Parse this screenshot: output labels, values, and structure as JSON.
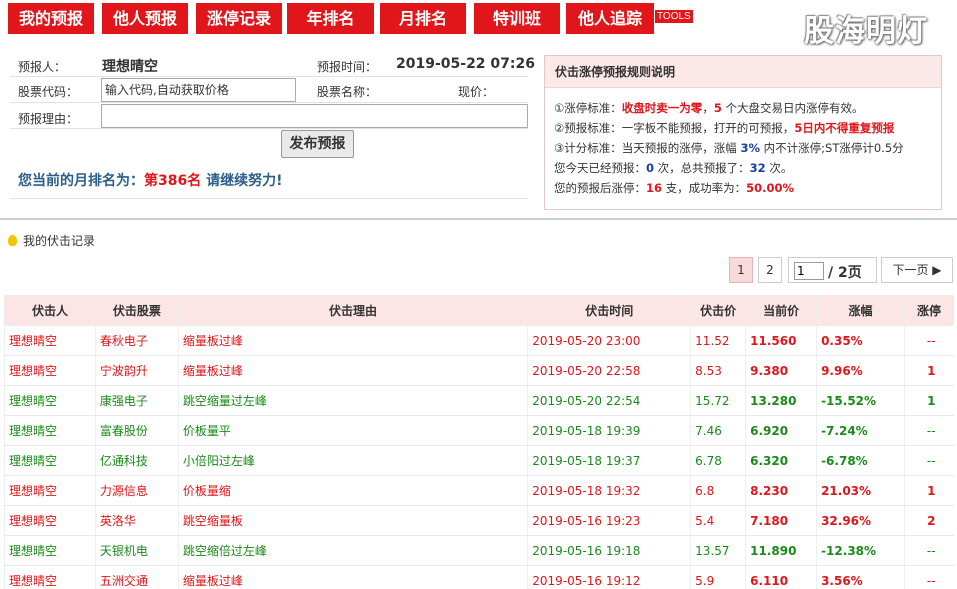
{
  "nav": {
    "tabs": [
      {
        "label": "我的预报"
      },
      {
        "label": "他人预报"
      },
      {
        "label": "涨停记录"
      },
      {
        "label": "年排名"
      },
      {
        "label": "月排名"
      },
      {
        "label": "特训班"
      },
      {
        "label": "他人追踪"
      }
    ],
    "tools_label": "TOOLS",
    "brand": "股海明灯"
  },
  "form": {
    "predictor_label": "预报人：",
    "predictor_value": "理想晴空",
    "time_label": "预报时间：",
    "time_value": "2019-05-22 07:26",
    "code_label": "股票代码：",
    "code_placeholder": "输入代码,自动获取价格",
    "name_label": "股票名称：",
    "price_label": "现价：",
    "reason_label": "预报理由：",
    "submit_label": "发布预报",
    "rank_prefix": "您当前的月排名为：",
    "rank_value": "第386名",
    "rank_suffix": " 请继续努力!"
  },
  "rules": {
    "title": "伏击涨停预报规则说明",
    "l1_a": "①涨停标准：",
    "l1_b": "收盘时卖一为零",
    "l1_c": "，",
    "l1_d": "5",
    "l1_e": " 个大盘交易日内涨停有效。",
    "l2_a": "②预报标准：一字板不能预报，打开的可预报，",
    "l2_b": "5日内不得重复预报",
    "l3_a": "③计分标准：当天预报的涨停，涨幅 ",
    "l3_b": "3%",
    "l3_c": " 内不计涨停;ST涨停计0.5分",
    "l4_a": "您今天已经预报：",
    "l4_b": "0",
    "l4_c": " 次，总共预报了：",
    "l4_d": "32",
    "l4_e": " 次。",
    "l5_a": "您的预报后涨停：",
    "l5_b": "16",
    "l5_c": " 支，成功率为：",
    "l5_d": "50.00%"
  },
  "section": {
    "title": "我的伏击记录"
  },
  "pager": {
    "page1": "1",
    "page2": "2",
    "current_input": "1",
    "total": "/ 2页",
    "next": "下一页 ▶"
  },
  "table": {
    "headers": [
      "伏击人",
      "伏击股票",
      "伏击理由",
      "伏击时间",
      "伏击价",
      "当前价",
      "涨幅",
      "涨停"
    ],
    "rows": [
      {
        "user": "理想晴空",
        "stock": "春秋电子",
        "reason": "缩量板过峰",
        "time": "2019-05-20 23:00",
        "price": "11.52",
        "current": "11.560",
        "change": "0.35%",
        "zt": "--",
        "dir": "up"
      },
      {
        "user": "理想晴空",
        "stock": "宁波韵升",
        "reason": "缩量板过峰",
        "time": "2019-05-20 22:58",
        "price": "8.53",
        "current": "9.380",
        "change": "9.96%",
        "zt": "1",
        "dir": "up"
      },
      {
        "user": "理想晴空",
        "stock": "康强电子",
        "reason": "跳空缩量过左峰",
        "time": "2019-05-20 22:54",
        "price": "15.72",
        "current": "13.280",
        "change": "-15.52%",
        "zt": "1",
        "dir": "dn"
      },
      {
        "user": "理想晴空",
        "stock": "富春股份",
        "reason": "价板量平",
        "time": "2019-05-18 19:39",
        "price": "7.46",
        "current": "6.920",
        "change": "-7.24%",
        "zt": "--",
        "dir": "dn"
      },
      {
        "user": "理想晴空",
        "stock": "亿通科技",
        "reason": "小倍阳过左峰",
        "time": "2019-05-18 19:37",
        "price": "6.78",
        "current": "6.320",
        "change": "-6.78%",
        "zt": "--",
        "dir": "dn"
      },
      {
        "user": "理想晴空",
        "stock": "力源信息",
        "reason": "价板量缩",
        "time": "2019-05-18 19:32",
        "price": "6.8",
        "current": "8.230",
        "change": "21.03%",
        "zt": "1",
        "dir": "up"
      },
      {
        "user": "理想晴空",
        "stock": "英洛华",
        "reason": "跳空缩量板",
        "time": "2019-05-16 19:23",
        "price": "5.4",
        "current": "7.180",
        "change": "32.96%",
        "zt": "2",
        "dir": "up"
      },
      {
        "user": "理想晴空",
        "stock": "天银机电",
        "reason": "跳空缩倍过左峰",
        "time": "2019-05-16 19:18",
        "price": "13.57",
        "current": "11.890",
        "change": "-12.38%",
        "zt": "--",
        "dir": "dn"
      },
      {
        "user": "理想晴空",
        "stock": "五洲交通",
        "reason": "缩量板过峰",
        "time": "2019-05-16 19:12",
        "price": "5.9",
        "current": "6.110",
        "change": "3.56%",
        "zt": "--",
        "dir": "up"
      }
    ]
  },
  "colors": {
    "brand_red": "#e0161b",
    "down_green": "#1a8a1a",
    "header_pink": "#fbe5e5"
  }
}
